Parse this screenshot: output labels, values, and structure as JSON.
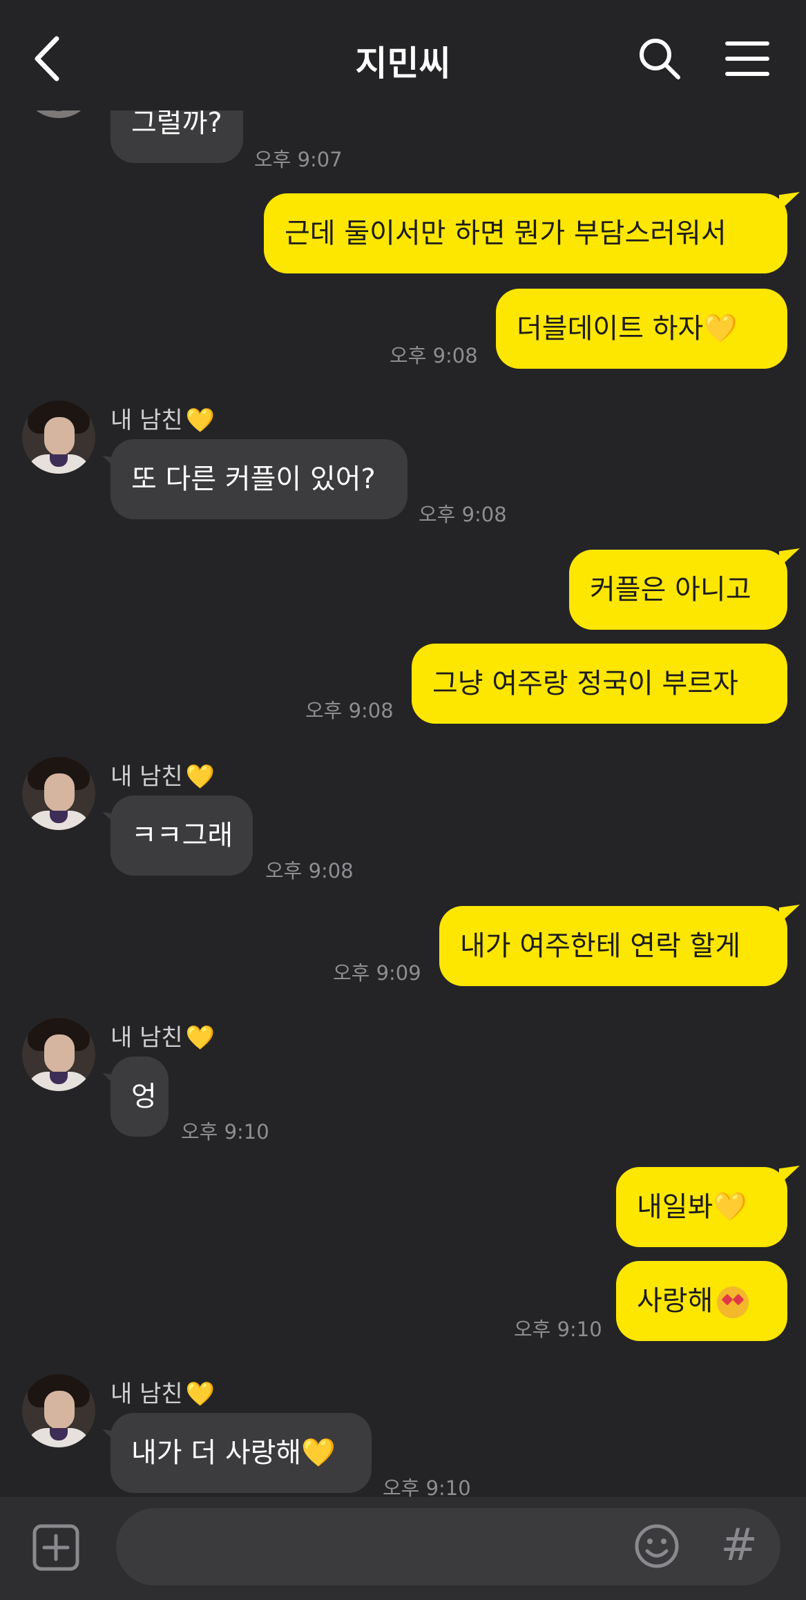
{
  "header": {
    "title": "지민씨"
  },
  "sender_name": "내 남친",
  "heart": "💛",
  "messages": [
    {
      "dir": "in",
      "text": "그럴까?",
      "time": "오후 9:07"
    },
    {
      "dir": "out",
      "text": "근데 둘이서만 하면 뭔가 부담스러워서",
      "time": ""
    },
    {
      "dir": "out",
      "text": "더블데이트 하자",
      "time": "오후 9:08"
    },
    {
      "dir": "in",
      "text": "또 다른 커플이 있어?",
      "time": "오후 9:08"
    },
    {
      "dir": "out",
      "text": "커플은 아니고",
      "time": ""
    },
    {
      "dir": "out",
      "text": "그냥 여주랑 정국이 부르자",
      "time": "오후 9:08"
    },
    {
      "dir": "in",
      "text": "ㅋㅋ그래",
      "time": "오후 9:08"
    },
    {
      "dir": "out",
      "text": "내가 여주한테 연락 할게",
      "time": "오후 9:09"
    },
    {
      "dir": "in",
      "text": "엉",
      "time": "오후 9:10"
    },
    {
      "dir": "out",
      "text": "내일봐",
      "time": ""
    },
    {
      "dir": "out",
      "text": "사랑해",
      "time": "오후 9:10"
    },
    {
      "dir": "in",
      "text": "내가 더 사랑해",
      "time": "오후 9:10"
    }
  ],
  "icons": {
    "back": "chevron-left-icon",
    "search": "search-icon",
    "menu": "hamburger-menu-icon",
    "plus": "plus-square-icon",
    "emoji": "smiley-icon",
    "hash": "#"
  },
  "colors": {
    "background": "#242426",
    "bubble_out": "#fde600",
    "bubble_in": "#3c3c3e"
  }
}
